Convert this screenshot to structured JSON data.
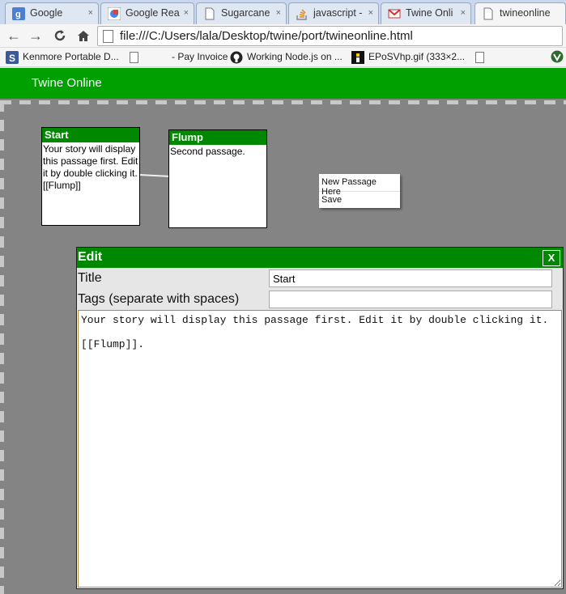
{
  "browser": {
    "tabs": [
      {
        "label": "Google",
        "icon": "google-icon"
      },
      {
        "label": "Google Rea",
        "icon": "google-reader-icon"
      },
      {
        "label": "Sugarcane",
        "icon": "page-icon"
      },
      {
        "label": "javascript -",
        "icon": "stackoverflow-icon"
      },
      {
        "label": "Twine Onli",
        "icon": "gmail-icon"
      },
      {
        "label": "twineonline",
        "icon": "page-icon"
      }
    ],
    "tab_close": "×",
    "url": "file:///C:/Users/lala/Desktop/twine/port/twineonline.html",
    "nav": {
      "back": "←",
      "forward": "→",
      "reload": "C",
      "home": "⌂"
    },
    "bookmarks": [
      {
        "label": "Kenmore Portable D...",
        "icon": "s-icon"
      },
      {
        "label": "",
        "icon": "page-icon"
      },
      {
        "label": "- Pay Invoice",
        "icon": ""
      },
      {
        "label": "Working Node.js on ...",
        "icon": "github-icon"
      },
      {
        "label": "EPoSVhp.gif (333×2...",
        "icon": "image-icon"
      },
      {
        "label": "",
        "icon": "page-icon"
      }
    ]
  },
  "app": {
    "title": "Twine Online",
    "colors": {
      "header": "#00a000",
      "passage_title": "#008800",
      "canvas": "#848484"
    },
    "passages": [
      {
        "title": "Start",
        "text": "Your story will display this passage first. Edit it by double clicking it. [[Flump]]"
      },
      {
        "title": "Flump",
        "text": "Second passage."
      }
    ],
    "context_menu": [
      "New Passage Here",
      "Save"
    ],
    "edit_dialog": {
      "title": "Edit",
      "close_label": "X",
      "title_label": "Title",
      "title_value": "Start",
      "tags_label": "Tags (separate with spaces)",
      "tags_value": "",
      "body": "Your story will display this passage first. Edit it by double clicking it.\n\n[[Flump]]."
    }
  }
}
